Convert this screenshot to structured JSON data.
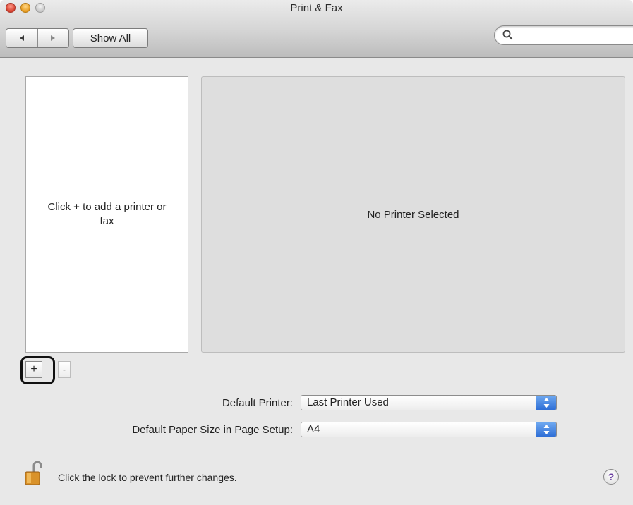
{
  "window": {
    "title": "Print & Fax"
  },
  "toolbar": {
    "back_icon": "triangle-left",
    "forward_icon": "triangle-right",
    "show_all_label": "Show All",
    "search": {
      "value": "",
      "placeholder": ""
    }
  },
  "printer_list": {
    "empty_message": "Click + to add a printer or fax"
  },
  "detail": {
    "message": "No Printer Selected"
  },
  "list_buttons": {
    "add_label": "+",
    "remove_label": "-"
  },
  "settings": {
    "default_printer": {
      "label": "Default Printer:",
      "value": "Last Printer Used"
    },
    "paper_size": {
      "label": "Default Paper Size in Page Setup:",
      "value": "A4"
    }
  },
  "footer": {
    "lock_message": "Click the lock to prevent further changes.",
    "help_label": "?"
  },
  "colors": {
    "close": "#d6402e",
    "minimize": "#e79a1e",
    "popup_accent": "#2f6fd6"
  }
}
